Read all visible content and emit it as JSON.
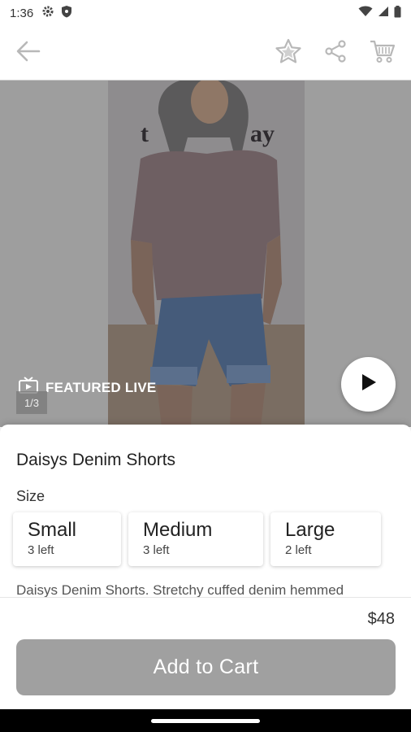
{
  "status_bar": {
    "time": "1:36",
    "icons": [
      "gear-icon",
      "shield-icon",
      "wifi-icon",
      "signal-icon",
      "battery-icon"
    ]
  },
  "app_bar": {
    "icons": [
      "arrow-left-icon",
      "star-outline-icon",
      "share-icon",
      "cart-icon"
    ]
  },
  "media": {
    "featured_label": "FEATURED LIVE",
    "featured_icon": "tv-icon",
    "page_indicator": "1/3",
    "play_icon": "play-icon"
  },
  "product": {
    "title": "Daisys Denim Shorts",
    "size_label": "Size",
    "sizes": [
      {
        "name": "Small",
        "stock": "3 left"
      },
      {
        "name": "Medium",
        "stock": "3 left"
      },
      {
        "name": "Large",
        "stock": "2 left"
      }
    ],
    "description": "Daisys Denim Shorts. Stretchy cuffed denim hemmed",
    "price": "$48",
    "add_to_cart_label": "Add to Cart"
  },
  "colors": {
    "button_disabled": "#a0a0a0",
    "icon_gray": "#b8b8b8",
    "media_background": "#9e9e9e"
  }
}
